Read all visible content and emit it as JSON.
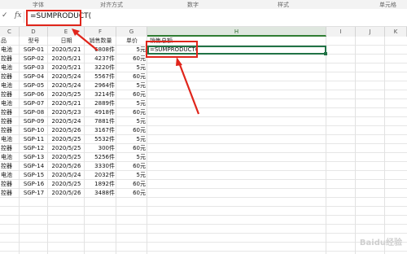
{
  "ribbon_groups": [
    "字体",
    "对齐方式",
    "数字",
    "样式",
    "单元格"
  ],
  "formula_bar": {
    "check_glyph": "✓",
    "fx_label": "fx",
    "formula": "=SUMPRODUCT("
  },
  "columns": [
    "C",
    "D",
    "E",
    "F",
    "G",
    "H",
    "I",
    "J",
    "K"
  ],
  "header_row": [
    "品",
    "型号",
    "日期",
    "销售数量",
    "单价",
    "销售总额"
  ],
  "rows": [
    [
      "电池",
      "SGP-01",
      "2020/5/21",
      "6808件",
      "5元",
      "=SUMPRODUCT("
    ],
    [
      "控器",
      "SGP-02",
      "2020/5/21",
      "4237件",
      "60元",
      ""
    ],
    [
      "电池",
      "SGP-03",
      "2020/5/21",
      "3220件",
      "5元",
      ""
    ],
    [
      "控器",
      "SGP-04",
      "2020/5/24",
      "5567件",
      "60元",
      ""
    ],
    [
      "电池",
      "SGP-05",
      "2020/5/24",
      "2964件",
      "5元",
      ""
    ],
    [
      "控器",
      "SGP-06",
      "2020/5/25",
      "3214件",
      "60元",
      ""
    ],
    [
      "电池",
      "SGP-07",
      "2020/5/21",
      "2889件",
      "5元",
      ""
    ],
    [
      "控器",
      "SGP-08",
      "2020/5/23",
      "4918件",
      "60元",
      ""
    ],
    [
      "控器",
      "SGP-09",
      "2020/5/24",
      "7881件",
      "5元",
      ""
    ],
    [
      "控器",
      "SGP-10",
      "2020/5/26",
      "3167件",
      "60元",
      ""
    ],
    [
      "电池",
      "SGP-11",
      "2020/5/25",
      "5532件",
      "5元",
      ""
    ],
    [
      "控器",
      "SGP-12",
      "2020/5/25",
      "300件",
      "60元",
      ""
    ],
    [
      "电池",
      "SGP-13",
      "2020/5/25",
      "5256件",
      "5元",
      ""
    ],
    [
      "控器",
      "SGP-14",
      "2020/5/26",
      "3330件",
      "60元",
      ""
    ],
    [
      "电池",
      "SGP-15",
      "2020/5/24",
      "2032件",
      "5元",
      ""
    ],
    [
      "控器",
      "SGP-16",
      "2020/5/25",
      "1892件",
      "60元",
      ""
    ],
    [
      "控器",
      "SGP-17",
      "2020/5/26",
      "3488件",
      "60元",
      ""
    ]
  ],
  "watermark": "Baidu经验",
  "colors": {
    "selection": "#217346",
    "annotation": "#e0251b"
  }
}
